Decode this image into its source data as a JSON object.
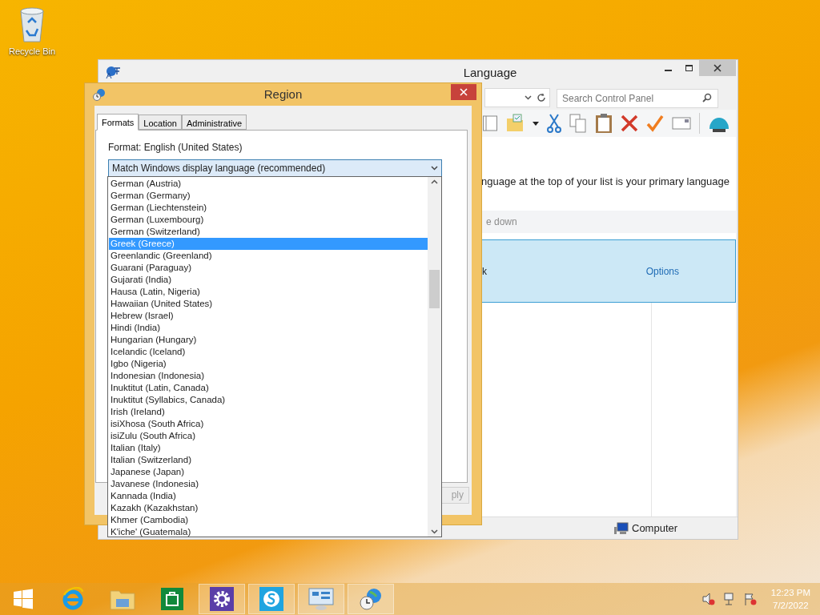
{
  "desktop_icons": [
    {
      "label": "Recycle Bin"
    }
  ],
  "language_window": {
    "title": "Language",
    "search": {
      "placeholder": "Search Control Panel"
    },
    "description": "nguage at the top of your list is your primary language",
    "command_bar": "e down",
    "language_row": {
      "name": "k",
      "link": "Options",
      "selected": true
    },
    "status_bar": "Computer"
  },
  "region_window": {
    "title": "Region",
    "tabs": [
      {
        "label": "Formats",
        "selected": true
      },
      {
        "label": "Location",
        "selected": false
      },
      {
        "label": "Administrative",
        "selected": false
      }
    ],
    "format_label": "Format: English (United States)",
    "dropdown": {
      "value": "Match Windows display language (recommended)",
      "expanded": true
    },
    "apply_button": "ply",
    "options": [
      {
        "label": "German (Austria)",
        "selected": false
      },
      {
        "label": "German (Germany)",
        "selected": false
      },
      {
        "label": "German (Liechtenstein)",
        "selected": false
      },
      {
        "label": "German (Luxembourg)",
        "selected": false
      },
      {
        "label": "German (Switzerland)",
        "selected": false
      },
      {
        "label": "Greek (Greece)",
        "selected": true
      },
      {
        "label": "Greenlandic (Greenland)",
        "selected": false
      },
      {
        "label": "Guarani (Paraguay)",
        "selected": false
      },
      {
        "label": "Gujarati (India)",
        "selected": false
      },
      {
        "label": "Hausa (Latin, Nigeria)",
        "selected": false
      },
      {
        "label": "Hawaiian (United States)",
        "selected": false
      },
      {
        "label": "Hebrew (Israel)",
        "selected": false
      },
      {
        "label": "Hindi (India)",
        "selected": false
      },
      {
        "label": "Hungarian (Hungary)",
        "selected": false
      },
      {
        "label": "Icelandic (Iceland)",
        "selected": false
      },
      {
        "label": "Igbo (Nigeria)",
        "selected": false
      },
      {
        "label": "Indonesian (Indonesia)",
        "selected": false
      },
      {
        "label": "Inuktitut (Latin, Canada)",
        "selected": false
      },
      {
        "label": "Inuktitut (Syllabics, Canada)",
        "selected": false
      },
      {
        "label": "Irish (Ireland)",
        "selected": false
      },
      {
        "label": "isiXhosa (South Africa)",
        "selected": false
      },
      {
        "label": "isiZulu (South Africa)",
        "selected": false
      },
      {
        "label": "Italian (Italy)",
        "selected": false
      },
      {
        "label": "Italian (Switzerland)",
        "selected": false
      },
      {
        "label": "Japanese (Japan)",
        "selected": false
      },
      {
        "label": "Javanese (Indonesia)",
        "selected": false
      },
      {
        "label": "Kannada (India)",
        "selected": false
      },
      {
        "label": "Kazakh (Kazakhstan)",
        "selected": false
      },
      {
        "label": "Khmer (Cambodia)",
        "selected": false
      },
      {
        "label": "K'iche' (Guatemala)",
        "selected": false
      }
    ]
  },
  "taskbar": {
    "apps": [
      {
        "kind": "start",
        "active": false
      },
      {
        "kind": "browser",
        "active": false
      },
      {
        "kind": "folder",
        "active": false
      },
      {
        "kind": "store",
        "active": false
      },
      {
        "kind": "settings",
        "active": true
      },
      {
        "kind": "chat",
        "active": true
      },
      {
        "kind": "control",
        "active": true
      },
      {
        "kind": "region",
        "active": true
      }
    ],
    "time": "12:23 PM",
    "date": "7/2/2022"
  }
}
